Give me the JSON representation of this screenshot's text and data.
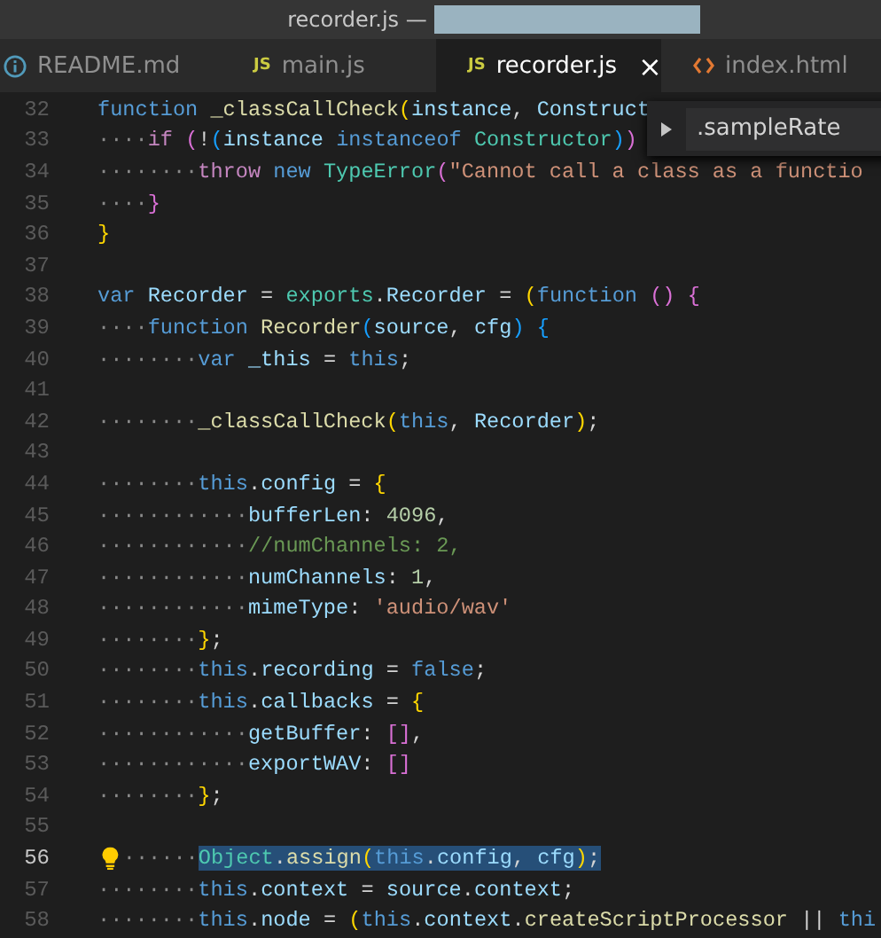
{
  "window": {
    "title": "recorder.js —"
  },
  "tabs": [
    {
      "kind": "markdown",
      "label": "README.md",
      "selected": false
    },
    {
      "kind": "javascript",
      "badge": "JS",
      "label": "main.js",
      "selected": false
    },
    {
      "kind": "javascript",
      "badge": "JS",
      "label": "recorder.js",
      "selected": true,
      "close": "×"
    },
    {
      "kind": "html",
      "label": "index.html",
      "selected": false
    }
  ],
  "suggestion": {
    "label": ".sampleRate"
  },
  "lines": [
    {
      "number": "32",
      "tokens": [
        {
          "kind": "storage",
          "text": "function "
        },
        {
          "kind": "func",
          "text": "_classCallCheck"
        },
        {
          "kind": "bracket1",
          "text": "("
        },
        {
          "kind": "var",
          "text": "instance"
        },
        {
          "kind": "punct",
          "text": ", "
        },
        {
          "kind": "var",
          "text": "Construct"
        }
      ]
    },
    {
      "number": "33",
      "tokens": [
        {
          "kind": "ws",
          "text": "····"
        },
        {
          "kind": "keyword",
          "text": "if "
        },
        {
          "kind": "bracket2",
          "text": "("
        },
        {
          "kind": "punct",
          "text": "!"
        },
        {
          "kind": "bracket3",
          "text": "("
        },
        {
          "kind": "var",
          "text": "instance"
        },
        {
          "kind": "storage",
          "text": " instanceof "
        },
        {
          "kind": "type",
          "text": "Constructor"
        },
        {
          "kind": "bracket3",
          "text": ")"
        },
        {
          "kind": "bracket2",
          "text": ")"
        }
      ]
    },
    {
      "number": "34",
      "tokens": [
        {
          "kind": "ws",
          "text": "········"
        },
        {
          "kind": "keyword",
          "text": "throw"
        },
        {
          "kind": "storage",
          "text": " new "
        },
        {
          "kind": "type",
          "text": "TypeError"
        },
        {
          "kind": "bracket2",
          "text": "("
        },
        {
          "kind": "string",
          "text": "\"Cannot call a class as a functio"
        }
      ]
    },
    {
      "number": "35",
      "tokens": [
        {
          "kind": "ws",
          "text": "····"
        },
        {
          "kind": "bracket2",
          "text": "}"
        }
      ]
    },
    {
      "number": "36",
      "tokens": [
        {
          "kind": "bracket1",
          "text": "}"
        }
      ]
    },
    {
      "number": "37"
    },
    {
      "number": "38",
      "tokens": [
        {
          "kind": "storage",
          "text": "var "
        },
        {
          "kind": "var",
          "text": "Recorder"
        },
        {
          "kind": "punct",
          "text": " = "
        },
        {
          "kind": "type",
          "text": "exports"
        },
        {
          "kind": "punct",
          "text": "."
        },
        {
          "kind": "var",
          "text": "Recorder"
        },
        {
          "kind": "punct",
          "text": " = "
        },
        {
          "kind": "bracket1",
          "text": "("
        },
        {
          "kind": "storage",
          "text": "function "
        },
        {
          "kind": "bracket2",
          "text": "() {"
        }
      ]
    },
    {
      "number": "39",
      "tokens": [
        {
          "kind": "ws",
          "text": "····"
        },
        {
          "kind": "storage",
          "text": "function "
        },
        {
          "kind": "func",
          "text": "Recorder"
        },
        {
          "kind": "bracket3",
          "text": "("
        },
        {
          "kind": "var",
          "text": "source"
        },
        {
          "kind": "punct",
          "text": ", "
        },
        {
          "kind": "var",
          "text": "cfg"
        },
        {
          "kind": "bracket3",
          "text": ") {"
        }
      ]
    },
    {
      "number": "40",
      "tokens": [
        {
          "kind": "ws",
          "text": "········"
        },
        {
          "kind": "storage",
          "text": "var "
        },
        {
          "kind": "var",
          "text": "_this"
        },
        {
          "kind": "punct",
          "text": " = "
        },
        {
          "kind": "storage",
          "text": "this"
        },
        {
          "kind": "punct",
          "text": ";"
        }
      ]
    },
    {
      "number": "41"
    },
    {
      "number": "42",
      "tokens": [
        {
          "kind": "ws",
          "text": "········"
        },
        {
          "kind": "func",
          "text": "_classCallCheck"
        },
        {
          "kind": "bracket1",
          "text": "("
        },
        {
          "kind": "storage",
          "text": "this"
        },
        {
          "kind": "punct",
          "text": ", "
        },
        {
          "kind": "var",
          "text": "Recorder"
        },
        {
          "kind": "bracket1",
          "text": ")"
        },
        {
          "kind": "punct",
          "text": ";"
        }
      ]
    },
    {
      "number": "43"
    },
    {
      "number": "44",
      "tokens": [
        {
          "kind": "ws",
          "text": "········"
        },
        {
          "kind": "storage",
          "text": "this"
        },
        {
          "kind": "punct",
          "text": "."
        },
        {
          "kind": "var",
          "text": "config"
        },
        {
          "kind": "punct",
          "text": " = "
        },
        {
          "kind": "bracket1",
          "text": "{"
        }
      ]
    },
    {
      "number": "45",
      "tokens": [
        {
          "kind": "ws",
          "text": "············"
        },
        {
          "kind": "var",
          "text": "bufferLen"
        },
        {
          "kind": "punct",
          "text": ": "
        },
        {
          "kind": "number",
          "text": "4096"
        },
        {
          "kind": "punct",
          "text": ","
        }
      ]
    },
    {
      "number": "46",
      "tokens": [
        {
          "kind": "ws",
          "text": "············"
        },
        {
          "kind": "comment",
          "text": "//numChannels: 2,"
        }
      ]
    },
    {
      "number": "47",
      "tokens": [
        {
          "kind": "ws",
          "text": "············"
        },
        {
          "kind": "var",
          "text": "numChannels"
        },
        {
          "kind": "punct",
          "text": ": "
        },
        {
          "kind": "number",
          "text": "1"
        },
        {
          "kind": "punct",
          "text": ","
        }
      ]
    },
    {
      "number": "48",
      "tokens": [
        {
          "kind": "ws",
          "text": "············"
        },
        {
          "kind": "var",
          "text": "mimeType"
        },
        {
          "kind": "punct",
          "text": ": "
        },
        {
          "kind": "string",
          "text": "'audio/wav'"
        }
      ]
    },
    {
      "number": "49",
      "tokens": [
        {
          "kind": "ws",
          "text": "········"
        },
        {
          "kind": "bracket1",
          "text": "}"
        },
        {
          "kind": "punct",
          "text": ";"
        }
      ]
    },
    {
      "number": "50",
      "tokens": [
        {
          "kind": "ws",
          "text": "········"
        },
        {
          "kind": "storage",
          "text": "this"
        },
        {
          "kind": "punct",
          "text": "."
        },
        {
          "kind": "var",
          "text": "recording"
        },
        {
          "kind": "punct",
          "text": " = "
        },
        {
          "kind": "storage",
          "text": "false"
        },
        {
          "kind": "punct",
          "text": ";"
        }
      ]
    },
    {
      "number": "51",
      "tokens": [
        {
          "kind": "ws",
          "text": "········"
        },
        {
          "kind": "storage",
          "text": "this"
        },
        {
          "kind": "punct",
          "text": "."
        },
        {
          "kind": "var",
          "text": "callbacks"
        },
        {
          "kind": "punct",
          "text": " = "
        },
        {
          "kind": "bracket1",
          "text": "{"
        }
      ]
    },
    {
      "number": "52",
      "tokens": [
        {
          "kind": "ws",
          "text": "············"
        },
        {
          "kind": "var",
          "text": "getBuffer"
        },
        {
          "kind": "punct",
          "text": ": "
        },
        {
          "kind": "bracket2",
          "text": "[]"
        },
        {
          "kind": "punct",
          "text": ","
        }
      ]
    },
    {
      "number": "53",
      "tokens": [
        {
          "kind": "ws",
          "text": "············"
        },
        {
          "kind": "var",
          "text": "exportWAV"
        },
        {
          "kind": "punct",
          "text": ": "
        },
        {
          "kind": "bracket2",
          "text": "[]"
        }
      ]
    },
    {
      "number": "54",
      "tokens": [
        {
          "kind": "ws",
          "text": "········"
        },
        {
          "kind": "bracket1",
          "text": "}"
        },
        {
          "kind": "punct",
          "text": ";"
        }
      ]
    },
    {
      "number": "55"
    },
    {
      "number": "56",
      "selected": true,
      "lightbulb": true,
      "tokens": [
        {
          "kind": "ws",
          "text": "······"
        },
        {
          "kind": "type",
          "text": "Object"
        },
        {
          "kind": "punct",
          "text": "."
        },
        {
          "kind": "func",
          "text": "assign"
        },
        {
          "kind": "bracket1",
          "text": "("
        },
        {
          "kind": "storage",
          "text": "this"
        },
        {
          "kind": "punct",
          "text": "."
        },
        {
          "kind": "var",
          "text": "config"
        },
        {
          "kind": "punct",
          "text": ", "
        },
        {
          "kind": "var",
          "text": "cfg"
        },
        {
          "kind": "bracket1",
          "text": ")"
        },
        {
          "kind": "punct",
          "text": ";"
        }
      ]
    },
    {
      "number": "57",
      "tokens": [
        {
          "kind": "ws",
          "text": "········"
        },
        {
          "kind": "storage",
          "text": "this"
        },
        {
          "kind": "punct",
          "text": "."
        },
        {
          "kind": "var",
          "text": "context"
        },
        {
          "kind": "punct",
          "text": " = "
        },
        {
          "kind": "var",
          "text": "source"
        },
        {
          "kind": "punct",
          "text": "."
        },
        {
          "kind": "var",
          "text": "context"
        },
        {
          "kind": "punct",
          "text": ";"
        }
      ]
    },
    {
      "number": "58",
      "tokens": [
        {
          "kind": "ws",
          "text": "········"
        },
        {
          "kind": "storage",
          "text": "this"
        },
        {
          "kind": "punct",
          "text": "."
        },
        {
          "kind": "var",
          "text": "node"
        },
        {
          "kind": "punct",
          "text": " = "
        },
        {
          "kind": "bracket1",
          "text": "("
        },
        {
          "kind": "storage",
          "text": "this"
        },
        {
          "kind": "punct",
          "text": "."
        },
        {
          "kind": "var",
          "text": "context"
        },
        {
          "kind": "punct",
          "text": "."
        },
        {
          "kind": "func",
          "text": "createScriptProcessor"
        },
        {
          "kind": "punct",
          "text": " || "
        },
        {
          "kind": "storage",
          "text": "thi"
        }
      ]
    }
  ]
}
